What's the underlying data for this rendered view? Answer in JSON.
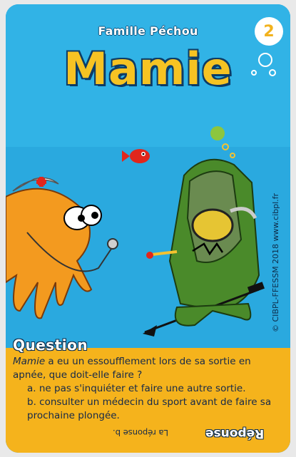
{
  "card": {
    "family": "Famille Péchou",
    "number": "2",
    "title": "Mamie",
    "copyright": "© CIBPL-FFESSM 2018 www.cibpl.fr"
  },
  "question": {
    "label": "Question",
    "subject": "Mamie",
    "text": " a eu un essoufflement lors de sa sortie en apnée, que doit-elle faire ?",
    "option_a": "a. ne pas s'inquiéter et faire une autre sortie.",
    "option_b": "b. consulter un médecin du sport avant de faire sa prochaine plongée.",
    "answer": "La réponse b.",
    "answer_label": "Réponse"
  },
  "colors": {
    "sea": "#2aa9df",
    "panel": "#f5b31c",
    "title": "#f6c323",
    "octopus": "#f39a1f",
    "diver": "#4a8a2a"
  }
}
